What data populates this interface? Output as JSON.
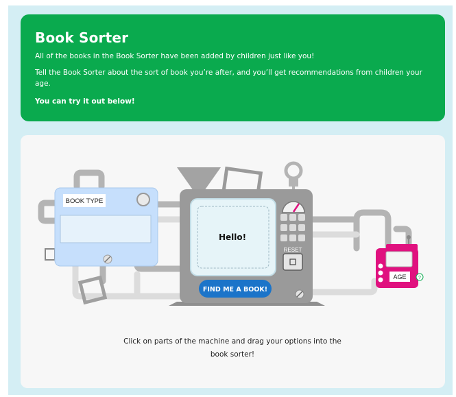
{
  "header": {
    "title": "Book Sorter",
    "intro": "All of the books in the Book Sorter have been added by children just like you!",
    "description": "Tell the Book Sorter about the sort of book you’re after, and you’ll get recommendations from children your age.",
    "cta": "You can try it out below!"
  },
  "machine": {
    "book_type_label": "BOOK TYPE",
    "screen_text": "Hello!",
    "reset_label": "RESET",
    "find_button_label": "FIND ME A BOOK!",
    "age_label": "AGE",
    "age_help": "?",
    "instructions": "Click on parts of the machine and drag your options into the book sorter!"
  },
  "colors": {
    "banner": "#0aaa4e",
    "frame": "#d4eef4",
    "book_type_module": "#c6dffc",
    "age_module": "#e0117f",
    "find_button": "#1b74c9",
    "machine_body": "#9a9a9a"
  }
}
